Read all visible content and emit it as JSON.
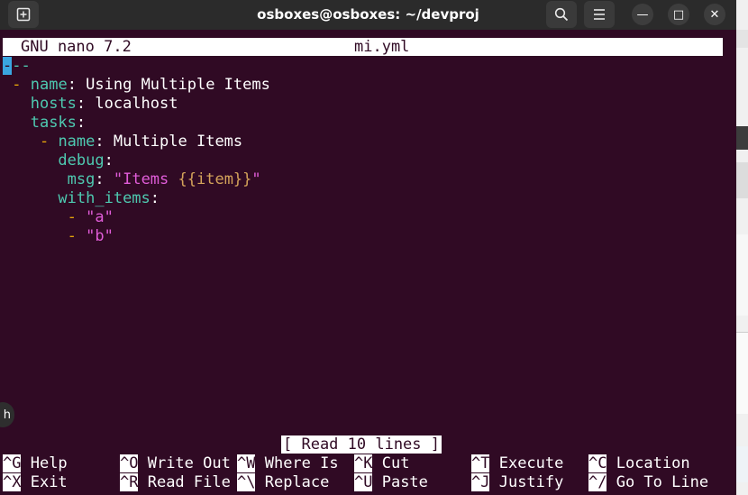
{
  "window": {
    "title": "osboxes@osboxes: ~/devproj",
    "buttons": {
      "new_tab_icon": "new-tab-icon",
      "search_icon": "search-icon",
      "menu_icon": "hamburger-menu-icon",
      "minimize": "—",
      "maximize": "□",
      "close": "✕"
    }
  },
  "nano": {
    "version": "GNU nano 7.2",
    "filename": "mi.yml",
    "lines": {
      "l1_dash_cursor": "-",
      "l1_dash_rest": "--",
      "l2_dash": "- ",
      "l2_key": "name",
      "l2_rest": ": Using Multiple Items",
      "l3_key": "hosts",
      "l3_rest": ": localhost",
      "l4_key": "tasks",
      "l4_rest": ":",
      "l5_dash": "- ",
      "l5_key": "name",
      "l5_rest": ": Multiple Items",
      "l6_key": "debug",
      "l6_rest": ":",
      "l7_key": "msg",
      "l7_colon": ": ",
      "l7_str_open": "\"Items ",
      "l7_tmpl": "{{item}}",
      "l7_str_close": "\"",
      "l8_key": "with_items",
      "l8_rest": ":",
      "l9_dash": "- ",
      "l9_str": "\"a\"",
      "l10_dash": "- ",
      "l10_str": "\"b\""
    },
    "status": "[ Read 10 lines ]",
    "shortcuts_row1": [
      {
        "key": "^G",
        "label": " Help"
      },
      {
        "key": "^O",
        "label": " Write Out"
      },
      {
        "key": "^W",
        "label": " Where Is"
      },
      {
        "key": "^K",
        "label": " Cut"
      },
      {
        "key": "^T",
        "label": " Execute"
      },
      {
        "key": "^C",
        "label": " Location"
      }
    ],
    "shortcuts_row2": [
      {
        "key": "^X",
        "label": " Exit"
      },
      {
        "key": "^R",
        "label": " Read File"
      },
      {
        "key": "^\\",
        "label": " Replace"
      },
      {
        "key": "^U",
        "label": " Paste"
      },
      {
        "key": "^J",
        "label": " Justify"
      },
      {
        "key": "^/",
        "label": " Go To Line"
      }
    ]
  },
  "side_tab": {
    "label": "h"
  },
  "colors": {
    "terminal_bg": "#300a24",
    "key": "#4ec9b0",
    "dash": "#e5a50a",
    "string": "#e05cd8",
    "template": "#d4a35a",
    "cursor": "#3aa6e0"
  }
}
